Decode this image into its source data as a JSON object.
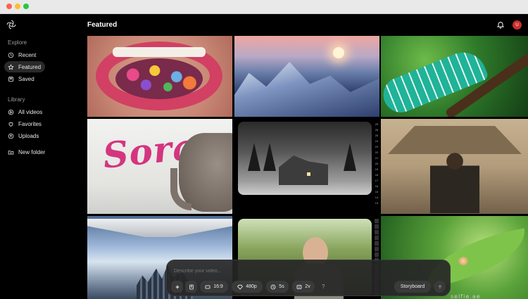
{
  "window": {
    "controls": [
      "close",
      "minimize",
      "zoom"
    ]
  },
  "header": {
    "title": "Featured",
    "avatar_initial": "U"
  },
  "sidebar": {
    "sections": [
      {
        "label": "Explore",
        "items": [
          {
            "label": "Recent",
            "icon": "clock-icon",
            "active": false
          },
          {
            "label": "Featured",
            "icon": "star-icon",
            "active": true
          },
          {
            "label": "Saved",
            "icon": "bookmark-icon",
            "active": false
          }
        ]
      },
      {
        "label": "Library",
        "items": [
          {
            "label": "All videos",
            "icon": "grid-icon",
            "active": false
          },
          {
            "label": "Favorites",
            "icon": "heart-icon",
            "active": false
          },
          {
            "label": "Uploads",
            "icon": "upload-icon",
            "active": false
          }
        ]
      }
    ],
    "new_folder": "New folder"
  },
  "gallery": {
    "tiles": [
      {
        "name": "lips-flowers"
      },
      {
        "name": "snowy-mountains-sunset"
      },
      {
        "name": "chameleon-branch"
      },
      {
        "name": "sora-elephant",
        "text": "Sora"
      },
      {
        "name": "snowy-cabins-night"
      },
      {
        "name": "man-village"
      },
      {
        "name": "city-aerial-plane"
      },
      {
        "name": "old-man-garden"
      },
      {
        "name": "snail-leaf"
      }
    ],
    "ruler_ticks": [
      "29",
      "26",
      "25",
      "24",
      "23",
      "22",
      "21",
      "20",
      "19",
      "18",
      "17",
      "16",
      "15",
      "14",
      "13"
    ]
  },
  "composer": {
    "placeholder": "Describe your video...",
    "aspect": "16:9",
    "resolution": "480p",
    "duration": "5s",
    "variations": "2v",
    "help": "?",
    "storyboard": "Storyboard"
  },
  "watermark": "selfie.ae"
}
